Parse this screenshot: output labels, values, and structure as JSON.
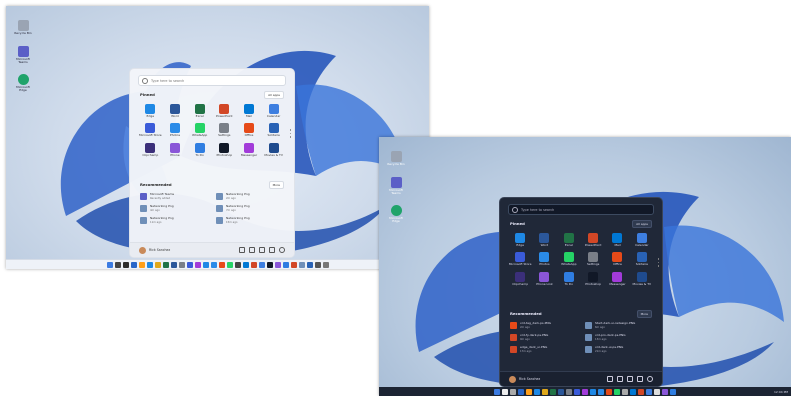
{
  "light": {
    "desktop_icons": [
      {
        "label": "Recycle Bin",
        "color": "#9aa4b3"
      },
      {
        "label": "Microsoft Teams",
        "color": "#5b5fc7"
      },
      {
        "label": "Microsoft Edge",
        "color": "#1fa36a"
      }
    ],
    "search_placeholder": "Type here to search",
    "pinned_title": "Pinned",
    "all_apps": "All apps",
    "pinned": [
      {
        "label": "Edge",
        "color": "#1e88e5"
      },
      {
        "label": "Word",
        "color": "#2b579a"
      },
      {
        "label": "Excel",
        "color": "#217346"
      },
      {
        "label": "PowerPoint",
        "color": "#d24726"
      },
      {
        "label": "Mail",
        "color": "#0078d4"
      },
      {
        "label": "Calendar",
        "color": "#3d7ee0"
      },
      {
        "label": "Microsoft Store",
        "color": "#3a5bd9"
      },
      {
        "label": "Photos",
        "color": "#2a8be8"
      },
      {
        "label": "WhatsApp",
        "color": "#25d366"
      },
      {
        "label": "Settings",
        "color": "#7a7f88"
      },
      {
        "label": "Office",
        "color": "#e64a19"
      },
      {
        "label": "Solitaire",
        "color": "#2962b5"
      },
      {
        "label": "Clipchamp",
        "color": "#3b2f7a"
      },
      {
        "label": "Phone",
        "color": "#8a56d8"
      },
      {
        "label": "To Do",
        "color": "#2f7de1"
      },
      {
        "label": "Photoshop",
        "color": "#111827"
      },
      {
        "label": "Messenger",
        "color": "#a23bd9"
      },
      {
        "label": "Movies & TV",
        "color": "#1f4b8e"
      }
    ],
    "rec_title": "Recommended",
    "more": "More",
    "recommended": [
      {
        "name": "Microsoft Teams",
        "sub": "Recently added",
        "color": "#5b5fc7"
      },
      {
        "name": "Networking Png",
        "sub": "2m ago",
        "color": "#6f8fb8"
      },
      {
        "name": "Networking Png",
        "sub": "4m ago",
        "color": "#6f8fb8"
      },
      {
        "name": "Networking Png",
        "sub": "7m ago",
        "color": "#6f8fb8"
      },
      {
        "name": "Networking Png",
        "sub": "11m ago",
        "color": "#6f8fb8"
      },
      {
        "name": "Networking Png",
        "sub": "15m ago",
        "color": "#6f8fb8"
      }
    ],
    "user": "Rick Sanchez",
    "taskbar_colors": [
      "#3b7be2",
      "#444",
      "#2c2c2c",
      "#2966c8",
      "#ff9f1a",
      "#1e88e5",
      "#e0a81b",
      "#217346",
      "#2b579a",
      "#7a7f88",
      "#3a5bd9",
      "#a23bd9",
      "#1e88e5",
      "#2a8be8",
      "#e64a19",
      "#25d366",
      "#444",
      "#0078d4",
      "#d24726",
      "#3d7ee0",
      "#111827",
      "#8a56d8",
      "#2f7de1",
      "#d24726",
      "#6f8fb8",
      "#2962b5",
      "#555",
      "#777"
    ],
    "tray": "12:04 PM"
  },
  "dark": {
    "desktop_icons": [
      {
        "label": "Recycle Bin",
        "color": "#9aa4b3"
      },
      {
        "label": "Microsoft Teams",
        "color": "#5b5fc7"
      },
      {
        "label": "Microsoft Edge",
        "color": "#1fa36a"
      }
    ],
    "search_placeholder": "Type here to search",
    "pinned_title": "Pinned",
    "all_apps": "All apps",
    "pinned": [
      {
        "label": "Edge",
        "color": "#1e88e5"
      },
      {
        "label": "Word",
        "color": "#2b579a"
      },
      {
        "label": "Excel",
        "color": "#217346"
      },
      {
        "label": "PowerPoint",
        "color": "#d24726"
      },
      {
        "label": "Mail",
        "color": "#0078d4"
      },
      {
        "label": "Calendar",
        "color": "#3d7ee0"
      },
      {
        "label": "Microsoft Store",
        "color": "#3a5bd9"
      },
      {
        "label": "Photos",
        "color": "#2a8be8"
      },
      {
        "label": "WhatsApp",
        "color": "#25d366"
      },
      {
        "label": "Settings",
        "color": "#7a7f88"
      },
      {
        "label": "Office",
        "color": "#e64a19"
      },
      {
        "label": "Solitaire",
        "color": "#2962b5"
      },
      {
        "label": "Clipchamp",
        "color": "#3b2f7a"
      },
      {
        "label": "Phone Link",
        "color": "#8a56d8"
      },
      {
        "label": "To Do",
        "color": "#2f7de1"
      },
      {
        "label": "Photoshop",
        "color": "#111827"
      },
      {
        "label": "Messenger",
        "color": "#a23bd9"
      },
      {
        "label": "Movies & TV",
        "color": "#1f4b8e"
      }
    ],
    "rec_title": "Recommended",
    "more": "More",
    "recommended": [
      {
        "name": "vrd-tag_dark-ps.PNG",
        "sub": "2m ago",
        "color": "#e64a19"
      },
      {
        "name": "Start-dark-ui-redesign.PNG",
        "sub": "6m ago",
        "color": "#6f8fb8"
      },
      {
        "name": "vrd-fy-dark-ps.PNG",
        "sub": "9m ago",
        "color": "#d24726"
      },
      {
        "name": "vrd-pro-dark-ps.PNG",
        "sub": "13m ago",
        "color": "#6f8fb8"
      },
      {
        "name": "edge_dark_ui.PNG",
        "sub": "17m ago",
        "color": "#d24726"
      },
      {
        "name": "vrd-dark-ui-ps.PNG",
        "sub": "21m ago",
        "color": "#6f8fb8"
      }
    ],
    "user": "Rick Sanchez",
    "taskbar_colors": [
      "#3b7be2",
      "#eee",
      "#aaa",
      "#2966c8",
      "#ff9f1a",
      "#1e88e5",
      "#e0a81b",
      "#217346",
      "#2b579a",
      "#7a7f88",
      "#3a5bd9",
      "#a23bd9",
      "#1e88e5",
      "#2a8be8",
      "#e64a19",
      "#25d366",
      "#aaa",
      "#0078d4",
      "#d24726",
      "#3d7ee0",
      "#ddd",
      "#8a56d8",
      "#2f7de1"
    ],
    "tray": "12:04 PM"
  }
}
